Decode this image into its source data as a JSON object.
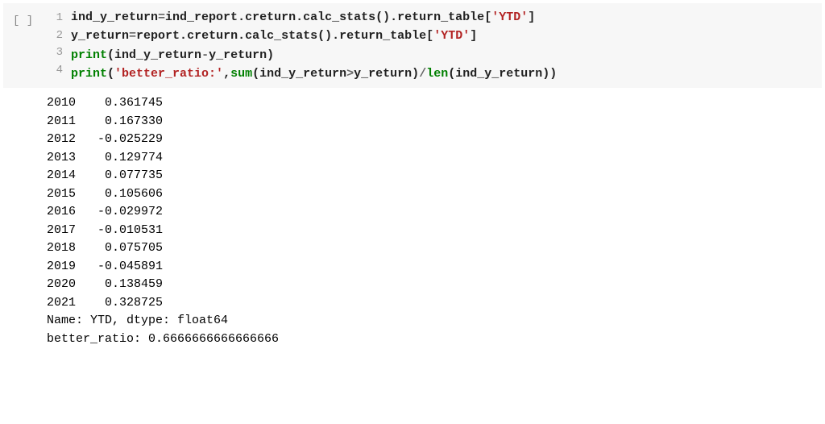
{
  "prompt": "[ ]",
  "code": {
    "lines": [
      {
        "n": "1",
        "tokens": [
          [
            "ind_y_return",
            "t-name"
          ],
          [
            "=",
            "t-op"
          ],
          [
            "ind_report",
            "t-name"
          ],
          [
            ".",
            "t-punct"
          ],
          [
            "creturn",
            "t-name"
          ],
          [
            ".",
            "t-punct"
          ],
          [
            "calc_stats",
            "t-name"
          ],
          [
            "()",
            "t-punct"
          ],
          [
            ".",
            "t-punct"
          ],
          [
            "return_table",
            "t-name"
          ],
          [
            "[",
            "t-punct"
          ],
          [
            "'YTD'",
            "t-str"
          ],
          [
            "]",
            "t-punct"
          ]
        ]
      },
      {
        "n": "2",
        "tokens": [
          [
            "y_return",
            "t-name"
          ],
          [
            "=",
            "t-op"
          ],
          [
            "report",
            "t-name"
          ],
          [
            ".",
            "t-punct"
          ],
          [
            "creturn",
            "t-name"
          ],
          [
            ".",
            "t-punct"
          ],
          [
            "calc_stats",
            "t-name"
          ],
          [
            "()",
            "t-punct"
          ],
          [
            ".",
            "t-punct"
          ],
          [
            "return_table",
            "t-name"
          ],
          [
            "[",
            "t-punct"
          ],
          [
            "'YTD'",
            "t-str"
          ],
          [
            "]",
            "t-punct"
          ]
        ]
      },
      {
        "n": "3",
        "tokens": [
          [
            "print",
            "t-builtin"
          ],
          [
            "(",
            "t-punct"
          ],
          [
            "ind_y_return",
            "t-name"
          ],
          [
            "-",
            "t-op"
          ],
          [
            "y_return",
            "t-name"
          ],
          [
            ")",
            "t-punct"
          ]
        ]
      },
      {
        "n": "4",
        "tokens": [
          [
            "print",
            "t-builtin"
          ],
          [
            "(",
            "t-punct"
          ],
          [
            "'better_ratio:'",
            "t-str"
          ],
          [
            ",",
            "t-punct"
          ],
          [
            "sum",
            "t-builtin"
          ],
          [
            "(",
            "t-punct"
          ],
          [
            "ind_y_return",
            "t-name"
          ],
          [
            ">",
            "t-op"
          ],
          [
            "y_return",
            "t-name"
          ],
          [
            ")",
            "t-punct"
          ],
          [
            "/",
            "t-op"
          ],
          [
            "len",
            "t-builtin"
          ],
          [
            "(",
            "t-punct"
          ],
          [
            "ind_y_return",
            "t-name"
          ],
          [
            "))",
            "t-punct"
          ]
        ]
      }
    ]
  },
  "output": {
    "rows": [
      {
        "year": "2010",
        "value": "0.361745"
      },
      {
        "year": "2011",
        "value": "0.167330"
      },
      {
        "year": "2012",
        "value": "-0.025229"
      },
      {
        "year": "2013",
        "value": "0.129774"
      },
      {
        "year": "2014",
        "value": "0.077735"
      },
      {
        "year": "2015",
        "value": "0.105606"
      },
      {
        "year": "2016",
        "value": "-0.029972"
      },
      {
        "year": "2017",
        "value": "-0.010531"
      },
      {
        "year": "2018",
        "value": "0.075705"
      },
      {
        "year": "2019",
        "value": "-0.045891"
      },
      {
        "year": "2020",
        "value": "0.138459"
      },
      {
        "year": "2021",
        "value": "0.328725"
      }
    ],
    "meta": "Name: YTD, dtype: float64",
    "ratio": "better_ratio: 0.6666666666666666"
  }
}
